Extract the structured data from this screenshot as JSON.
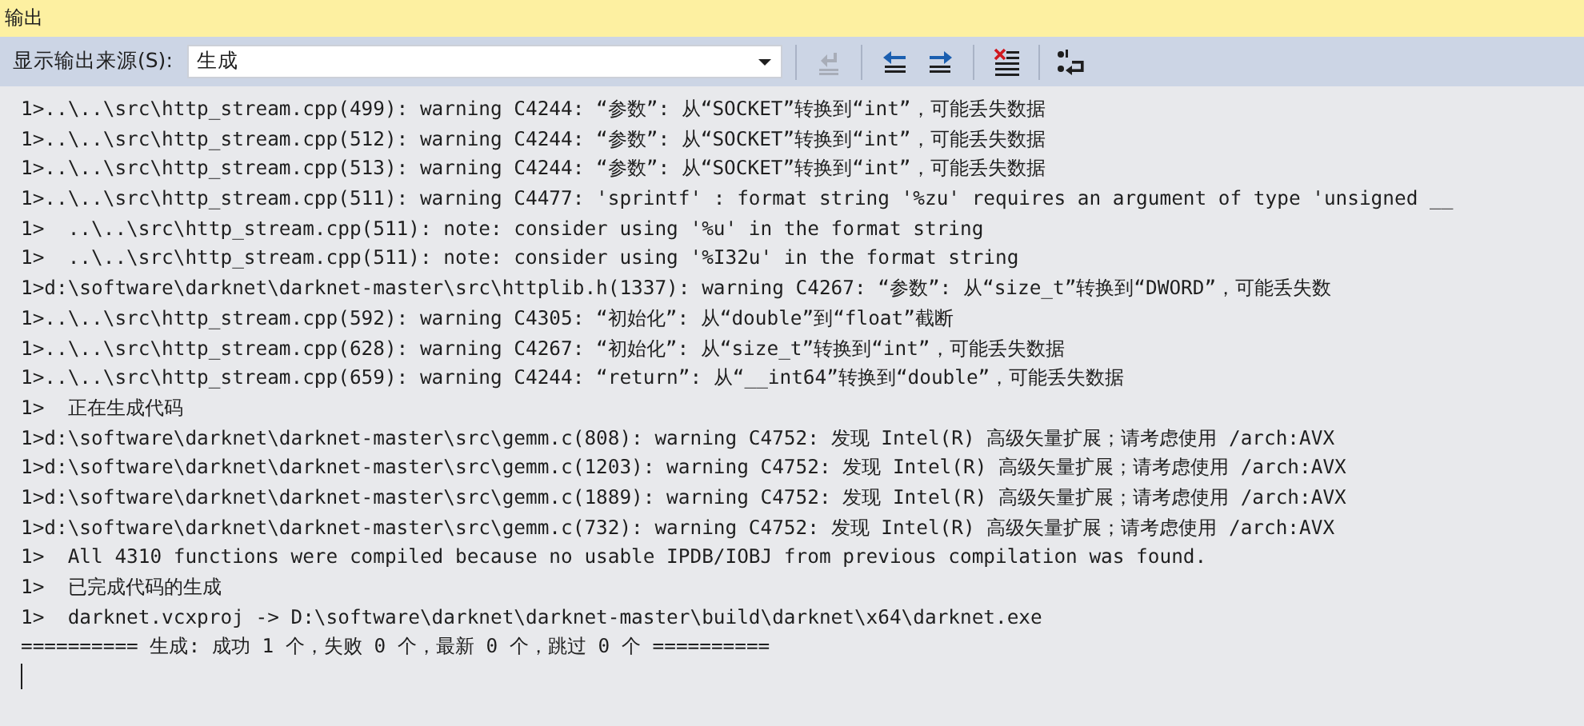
{
  "panel": {
    "title": "输出"
  },
  "toolbar": {
    "source_label": "显示输出来源(S):",
    "source_value": "生成",
    "buttons": [
      {
        "kind": "goto",
        "disabled": true
      },
      {
        "kind": "prev",
        "disabled": false
      },
      {
        "kind": "next",
        "disabled": false
      },
      {
        "kind": "clear",
        "disabled": false
      },
      {
        "kind": "wrap",
        "disabled": false
      }
    ]
  },
  "lines": [
    "1>..\\..\\src\\http_stream.cpp(499): warning C4244: “参数”: 从“SOCKET”转换到“int”，可能丢失数据",
    "1>..\\..\\src\\http_stream.cpp(512): warning C4244: “参数”: 从“SOCKET”转换到“int”，可能丢失数据",
    "1>..\\..\\src\\http_stream.cpp(513): warning C4244: “参数”: 从“SOCKET”转换到“int”，可能丢失数据",
    "1>..\\..\\src\\http_stream.cpp(511): warning C4477: 'sprintf' : format string '%zu' requires an argument of type 'unsigned __",
    "1>  ..\\..\\src\\http_stream.cpp(511): note: consider using '%u' in the format string",
    "1>  ..\\..\\src\\http_stream.cpp(511): note: consider using '%I32u' in the format string",
    "1>d:\\software\\darknet\\darknet-master\\src\\httplib.h(1337): warning C4267: “参数”: 从“size_t”转换到“DWORD”，可能丢失数",
    "1>..\\..\\src\\http_stream.cpp(592): warning C4305: “初始化”: 从“double”到“float”截断",
    "1>..\\..\\src\\http_stream.cpp(628): warning C4267: “初始化”: 从“size_t”转换到“int”，可能丢失数据",
    "1>..\\..\\src\\http_stream.cpp(659): warning C4244: “return”: 从“__int64”转换到“double”，可能丢失数据",
    "1>  正在生成代码",
    "1>d:\\software\\darknet\\darknet-master\\src\\gemm.c(808): warning C4752: 发现 Intel(R) 高级矢量扩展；请考虑使用 /arch:AVX",
    "1>d:\\software\\darknet\\darknet-master\\src\\gemm.c(1203): warning C4752: 发现 Intel(R) 高级矢量扩展；请考虑使用 /arch:AVX",
    "1>d:\\software\\darknet\\darknet-master\\src\\gemm.c(1889): warning C4752: 发现 Intel(R) 高级矢量扩展；请考虑使用 /arch:AVX",
    "1>d:\\software\\darknet\\darknet-master\\src\\gemm.c(732): warning C4752: 发现 Intel(R) 高级矢量扩展；请考虑使用 /arch:AVX",
    "1>  All 4310 functions were compiled because no usable IPDB/IOBJ from previous compilation was found.",
    "1>  已完成代码的生成",
    "1>  darknet.vcxproj -> D:\\software\\darknet\\darknet-master\\build\\darknet\\x64\\darknet.exe",
    "========== 生成: 成功 1 个，失败 0 个，最新 0 个，跳过 0 个 =========="
  ]
}
